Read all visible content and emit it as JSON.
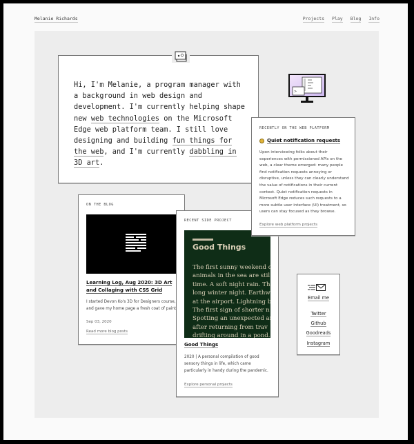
{
  "header": {
    "site_name": "Melanie Richards",
    "nav": [
      "Projects",
      "Play",
      "Blog",
      "Info"
    ]
  },
  "intro": {
    "icon": "window-stack-icon",
    "text_1": "Hi, I'm Melanie, a program manager with a background in web design and development. I'm currently helping shape new ",
    "link_1": "web technologies",
    "text_2": " on the Microsoft Edge web platform team. I still love designing and building ",
    "link_2": "fun things for the web",
    "text_3": ", and I'm currently ",
    "link_3": "dabbling in 3D art",
    "text_4": "."
  },
  "web_platform": {
    "icon": "monitor-icon",
    "eyebrow": "RECENTLY ON THE WEB PLATFORM",
    "title_icon": "worried-face-emoji",
    "title": "Quiet notification requests",
    "body": "Upon interviewing folks about their experiences with permissioned APIs on the web, a clear theme emerged: many people find notification requests annoying or disruptive, unless they can clearly understand the value of notifications in their current context. Quiet notification requests in Microsoft Edge reduces such requests to a more subtle user interface (UI) treatment, so users can stay focused as they browse.",
    "link": "Explore web platform projects"
  },
  "blog": {
    "eyebrow": "ON THE BLOG",
    "thumbnail_icon": "text-lines-icon",
    "title": "Learning Log, Aug 2020: 3D Art and Collaging with CSS Grid",
    "body": "I started Devon Ko's 3D for Designers course, and gave my home page a fresh coat of paint.",
    "date": "Sep 03, 2020",
    "link": "Read more blog posts"
  },
  "side_project": {
    "eyebrow": "RECENT SIDE PROJECT",
    "thumb_title": "Good Things",
    "thumb_lines": [
      "The first sunny weekend o",
      "animals in the sea are stil",
      "time. A soft night rain. Th",
      "long winter night. Earthw",
      "at the airport. Lightning b",
      "The first sign of shorter n",
      "Spotting an unexpected ar",
      "after returning from trav",
      "drifting around in a pond."
    ],
    "title": "Good Things",
    "body": "2020 | A personal compilation of good sensory things in life, which came particularly in handy during the pandemic.",
    "link": "Explore personal projects"
  },
  "contact": {
    "icon": "email-icon",
    "email": "Email me",
    "links": [
      "Twitter",
      "Github",
      "Goodreads",
      "Instagram"
    ]
  }
}
